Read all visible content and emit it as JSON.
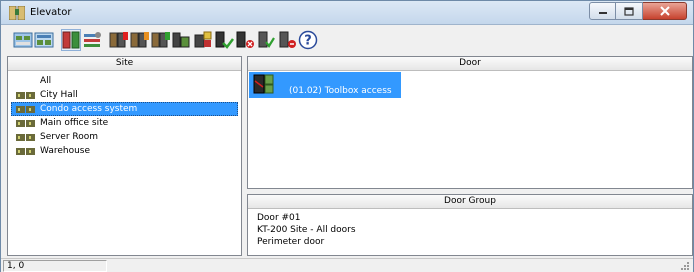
{
  "window": {
    "title": "Elevator",
    "buttons": {
      "minimize": "minimize",
      "maximize": "maximize",
      "close": "close"
    }
  },
  "toolbar": {
    "buttons": [
      {
        "icon": "sites-view-icon"
      },
      {
        "icon": "sites-list-icon"
      },
      {
        "icon": "elevator-doors-icon",
        "active": true
      },
      {
        "icon": "elevator-settings-icon"
      },
      {
        "icon": "unlock-door-icon"
      },
      {
        "icon": "lock-door-icon"
      },
      {
        "icon": "door-schedule-icon"
      },
      {
        "icon": "door-normal-icon"
      },
      {
        "icon": "door-configure-icon"
      },
      {
        "icon": "door-enable-icon"
      },
      {
        "icon": "door-disable-icon"
      },
      {
        "icon": "door-generic-icon"
      },
      {
        "icon": "door-remove-icon"
      },
      {
        "icon": "help-icon"
      }
    ]
  },
  "site_panel": {
    "header": "Site",
    "items": [
      {
        "label": "All"
      },
      {
        "label": "City Hall"
      },
      {
        "label": "Condo access system",
        "selected": true
      },
      {
        "label": "Main office site"
      },
      {
        "label": "Server Room"
      },
      {
        "label": "Warehouse"
      }
    ]
  },
  "door_panel": {
    "header": "Door",
    "items": [
      {
        "label": "(01.02) Toolbox access",
        "selected": true
      }
    ]
  },
  "group_panel": {
    "header": "Door Group",
    "items": [
      {
        "label": "Door #01"
      },
      {
        "label": "KT-200 Site - All doors"
      },
      {
        "label": "Perimeter door"
      }
    ]
  },
  "statusbar": {
    "position": "1, 0"
  },
  "colors": {
    "selection": "#3399ff",
    "titlebar": "#c4d7ec",
    "close": "#c7422e"
  }
}
